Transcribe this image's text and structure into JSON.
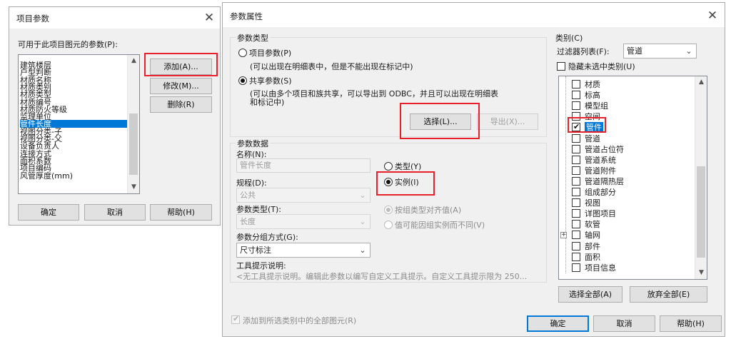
{
  "project_params_dialog": {
    "title": "项目参数",
    "list_label": "可用于此项目图元的参数(P):",
    "params": [
      "建筑楼层",
      "户型判断",
      "材质名称",
      "材质类别",
      "材质类型",
      "材质编号",
      "材质防火等级",
      "监理单位",
      "管件长度",
      "视图分类-子",
      "视图分类-父",
      "设备负责人",
      "连接方式",
      "面积系数",
      "项目编码",
      "风管厚度(mm)"
    ],
    "selected_param": "管件长度",
    "add_button": "添加(A)...",
    "modify_button": "修改(M)...",
    "delete_button": "删除(R)",
    "ok_button": "确定",
    "cancel_button": "取消",
    "help_button": "帮助(H)"
  },
  "param_props_dialog": {
    "title": "参数属性",
    "param_type_group": "参数类型",
    "project_param_radio": "项目参数(P)",
    "project_param_desc": "(可以出现在明细表中，但是不能出现在标记中)",
    "shared_param_radio": "共享参数(S)",
    "shared_param_desc_1": "(可以由多个项目和族共享，可以导出到 ODBC，并且可以出现在明细表",
    "shared_param_desc_2": "和标记中)",
    "select_button": "选择(L)...",
    "export_button": "导出(X)...",
    "param_data_group": "参数数据",
    "name_label": "名称(N):",
    "name_value": "管件长度",
    "type_radio": "类型(Y)",
    "instance_radio": "实例(I)",
    "discipline_label": "规程(D):",
    "discipline_value": "公共",
    "param_type_label": "参数类型(T):",
    "param_type_value": "长度",
    "align_group_type": "按组类型对齐值(A)",
    "vary_by_group": "值可能因组实例而不同(V)",
    "group_under_label": "参数分组方式(G):",
    "group_under_value": "尺寸标注",
    "tooltip_label": "工具提示说明:",
    "tooltip_value": "<无工具提示说明。编辑此参数以编写自定义工具提示。自定义工具提示限为 250...",
    "category_group": "类别(C)",
    "filter_label": "过滤器列表(F):",
    "filter_value": "管道",
    "hide_unchecked": "隐藏未选中类别(U)",
    "categories": [
      {
        "label": "材质",
        "checked": false
      },
      {
        "label": "标高",
        "checked": false
      },
      {
        "label": "模型组",
        "checked": false
      },
      {
        "label": "空间",
        "checked": false
      },
      {
        "label": "管件",
        "checked": true
      },
      {
        "label": "管道",
        "checked": false
      },
      {
        "label": "管道占位符",
        "checked": false
      },
      {
        "label": "管道系统",
        "checked": false
      },
      {
        "label": "管道附件",
        "checked": false
      },
      {
        "label": "管道隔热层",
        "checked": false
      },
      {
        "label": "组成部分",
        "checked": false
      },
      {
        "label": "视图",
        "checked": false
      },
      {
        "label": "详图项目",
        "checked": false
      },
      {
        "label": "软管",
        "checked": false
      },
      {
        "label": "轴网",
        "checked": false
      },
      {
        "label": "部件",
        "checked": false
      },
      {
        "label": "面积",
        "checked": false
      },
      {
        "label": "项目信息",
        "checked": false
      }
    ],
    "select_all_button": "选择全部(A)",
    "check_none_button": "放弃全部(E)",
    "add_to_all_label": "添加到所选类别中的全部图元(R)",
    "ok_button": "确定",
    "cancel_button": "取消",
    "help_button": "帮助(H)"
  },
  "colors": {
    "highlight_red": "#e8202a",
    "selection_blue": "#0078d7"
  }
}
